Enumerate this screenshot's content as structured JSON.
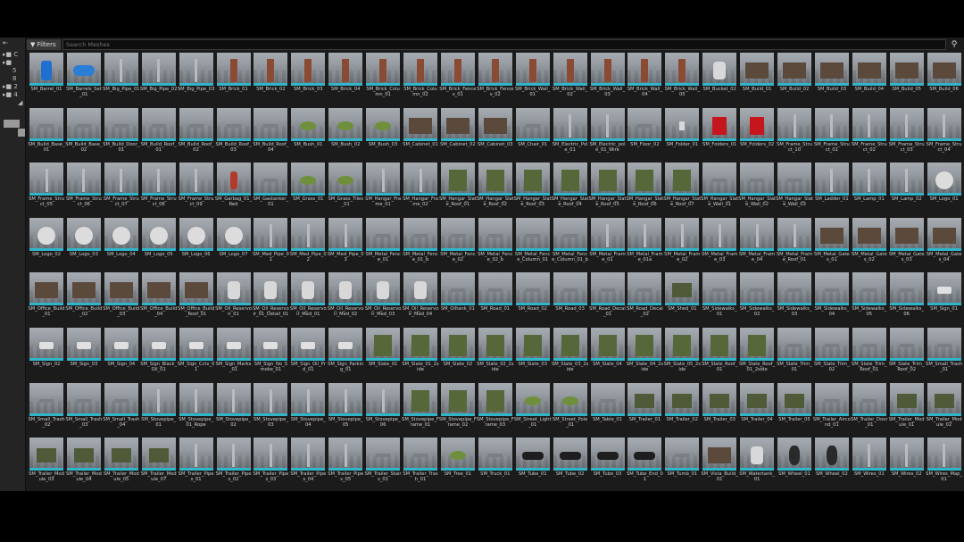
{
  "toolbar": {
    "filters_label": "▼ Filters ▾",
    "search_placeholder": "Search Meshes",
    "search_icon": "search-icon"
  },
  "left_panel": {
    "items": [
      "C",
      "5",
      "8",
      "2",
      "4"
    ]
  },
  "accent_color": "#31b5c9",
  "assets": [
    "SM_Barrel_01",
    "SM_Barrels_Set_01",
    "SM_Big_Pipe_01",
    "SM_Big_Pipe_02",
    "SM_Big_Pipe_03",
    "SM_Brick_01",
    "SM_Brick_02",
    "SM_Brick_03",
    "SM_Brick_04",
    "SM_Brick_Column_01",
    "SM_Brick_Column_02",
    "SM_Brick_Fences_01",
    "SM_Brick_Fences_02",
    "SM_Brick_Wall_01",
    "SM_Brick_Wall_02",
    "SM_Brick_Wall_03",
    "SM_Brick_Wall_04",
    "SM_Brick_Wall_05",
    "SM_Bucket_02",
    "SM_Build_01",
    "SM_Build_02",
    "SM_Build_03",
    "SM_Build_04",
    "SM_Build_05",
    "SM_Build_06",
    "SM_Build_Base_01",
    "SM_Build_Base_02",
    "SM_Build_Door_01",
    "SM_Build_Roof_01",
    "SM_Build_Roof_02",
    "SM_Build_Roof_03",
    "SM_Build_Roof_04",
    "SM_Bush_01",
    "SM_Bush_02",
    "SM_Bush_03",
    "SM_Cabinet_01",
    "SM_Cabinet_02",
    "SM_Cabinet_03",
    "SM_Chair_01",
    "SM_Electric_Pole_01",
    "SM_Electric_pole_01_Wire",
    "SM_Floor_02",
    "SM_Folder_01",
    "SM_Folders_01",
    "SM_Folders_02",
    "SM_Frame_Struct_10",
    "SM_Frame_Struct_01",
    "SM_Frame_Struct_02",
    "SM_Frame_Struct_03",
    "SM_Frame_Struct_04",
    "SM_Frame_Struct_05",
    "SM_Frame_Struct_06",
    "SM_Frame_Struct_07",
    "SM_Frame_Struct_08",
    "SM_Frame_Struct_09",
    "SM_Garbag_01_Red",
    "SM_Gastanker_01",
    "SM_Grass_01",
    "SM_Grass_Tiles_01",
    "SM_Hangar_Frame_01",
    "SM_Hangar_Frame_02",
    "SM_Hangar_Slate_Roof_01",
    "SM_Hangar_Slate_Roof_02",
    "SM_Hangar_Slate_Roof_03",
    "SM_Hangar_Slate_Roof_04",
    "SM_Hangar_Slate_Roof_05",
    "SM_Hangar_Slate_Roof_06",
    "SM_Hangar_Slate_Roof_07",
    "SM_Hangar_Slate_Wall_01",
    "SM_Hangar_Slate_Wall_02",
    "SM_Hangar_Slate_Wall_03",
    "SM_Ladder_01",
    "SM_Lamp_01",
    "SM_Lamp_02",
    "SM_Logo_01",
    "SM_Logo_02",
    "SM_Logo_03",
    "SM_Logo_04",
    "SM_Logo_05",
    "SM_Logo_06",
    "SM_Logo_07",
    "SM_Med_Pipe_01",
    "SM_Med_Pipe_02",
    "SM_Med_Pipe_03",
    "SM_Metal_Fence_01",
    "SM_Metal_Fence_01_b",
    "SM_Metal_Fence_02",
    "SM_Metal_Fence_02_b",
    "SM_Metal_Fence_Column_01",
    "SM_Metal_Fence_Column_01_b",
    "SM_Metal_Frame_01",
    "SM_Metal_Frame_01a",
    "SM_Metal_Frame_02",
    "SM_Metal_Frame_03",
    "SM_Metal_Frame_04",
    "SM_Metal_Frame_Roof_01",
    "SM_Metal_Gates_01",
    "SM_Metal_Gates_02",
    "SM_Metal_Gates_03",
    "SM_Metal_Gates_04",
    "SM_Office_Build_01",
    "SM_Office_Build_02",
    "SM_Office_Build_03",
    "SM_Office_Build_04",
    "SM_Office_Build_Roof_01",
    "SM_Oil_Reservoir_01",
    "SM_Oil_Reservoir_01_Detail_01",
    "SM_Oil_Reservoir_Med_01",
    "SM_Oil_Reservoir_Med_02",
    "SM_Oil_Reservoir_Med_03",
    "SM_Oil_Reservoir_Med_04",
    "SM_Oiltank_01",
    "SM_Road_01",
    "SM_Road_02",
    "SM_Road_03",
    "SM_Road_Decal_01",
    "SM_Road_Decal_02",
    "SM_Shed_01",
    "SM_Sidewalks_01",
    "SM_Sidewalks_02",
    "SM_Sidewalks_03",
    "SM_Sidewalks_04",
    "SM_Sidewalks_05",
    "SM_Sidewalks_06",
    "SM_Sign_01",
    "SM_Sign_02",
    "SM_Sign_03",
    "SM_Sign_04",
    "SM_Sign_Black_Oil_01",
    "SM_Sign_Cctv_01",
    "SM_Sign_Marks_01",
    "SM_Sign_No_Smoke_01",
    "SM_Sign_Oil_Prd_01",
    "SM_Sign_Parking_01",
    "SM_Slate_01",
    "SM_Slate_01_2side",
    "SM_Slate_02",
    "SM_Slate_02_2side",
    "SM_Slate_03",
    "SM_Slate_03_2side",
    "SM_Slate_04",
    "SM_Slate_04_2side",
    "SM_Slate_05_2side",
    "SM_Slate_Roof_01",
    "SM_Slate_Roof_01_2side",
    "SM_Slate_Trim_01",
    "SM_Slate_Trim_02",
    "SM_Slate_Trim_Roof_01",
    "SM_Slate_Trim_Roof_02",
    "SM_Small_Trash_01",
    "SM_Small_Trash_02",
    "SM_Small_Trash_03",
    "SM_Small_Trash_04",
    "SM_Stovepipe_01",
    "SM_Stovepipe_01_Rope",
    "SM_Stovepipe_02",
    "SM_Stovepipe_03",
    "SM_Stovepipe_04",
    "SM_Stovepipe_05",
    "SM_Stovepipe_06",
    "SM_Stovepipe_Frame_01",
    "SM_Stovepipe_Frame_02",
    "SM_Stovepipe_Frame_03",
    "SM_Street_Light_01",
    "SM_Street_Pole_01",
    "SM_Table_01",
    "SM_Trailer_01",
    "SM_Trailer_02",
    "SM_Trailer_03",
    "SM_Trailer_04",
    "SM_Trailer_05",
    "SM_Trailer_Aircond_01",
    "SM_Trailer_Door_01",
    "SM_Trailer_Module_01",
    "SM_Trailer_Module_02",
    "SM_Trailer_Module_03",
    "SM_Trailer_Module_04",
    "SM_Trailer_Module_05",
    "SM_Trailer_Module_07",
    "SM_Trailer_Pipes_01",
    "SM_Trailer_Pipes_02",
    "SM_Trailer_Pipes_03",
    "SM_Trailer_Pipes_04",
    "SM_Trailer_Pipes_05",
    "SM_Trailer_Stairs_01",
    "SM_Trailer_Trash_01",
    "SM_Tree_01",
    "SM_Truck_01",
    "SM_Tube_01",
    "SM_Tube_02",
    "SM_Tube_03",
    "SM_Tube_End_01",
    "SM_Tumb_01",
    "SM_Vista_Build_01",
    "SM_Watertank_01",
    "SM_Wheel_01",
    "SM_Wheel_02",
    "SM_Wires_01",
    "SM_Wires_02",
    "SM_Wires_Map_01"
  ]
}
